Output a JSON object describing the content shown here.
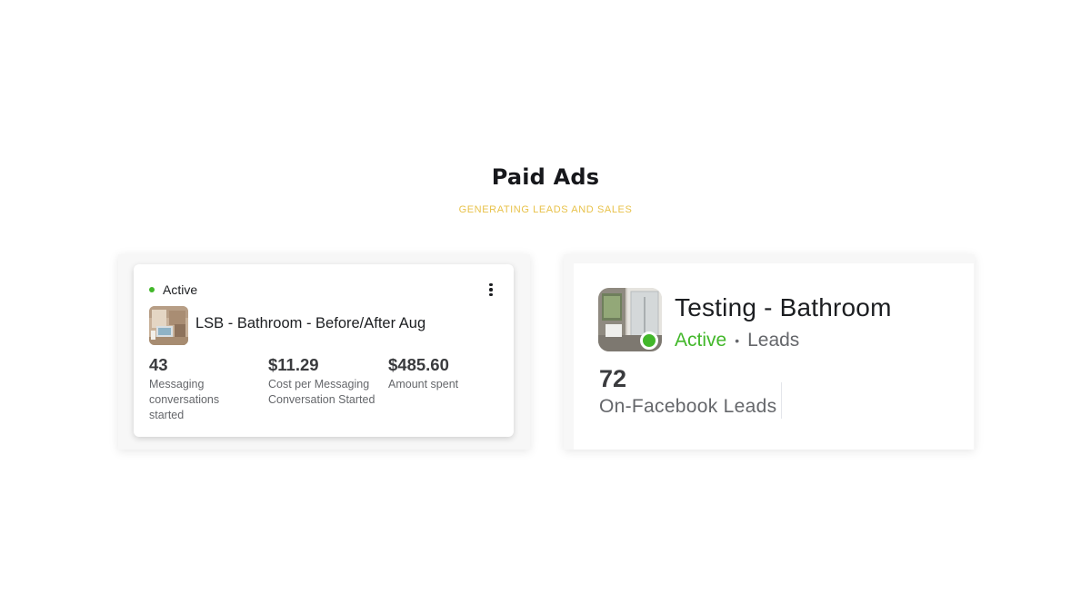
{
  "header": {
    "title": "Paid Ads",
    "subtitle": "GENERATING LEADS AND SALES"
  },
  "colors": {
    "active_green": "#42b72a",
    "title": "#17181c",
    "subtitle": "#e8c24a",
    "muted_text": "#65676b"
  },
  "left_ad": {
    "status": "Active",
    "name": "LSB - Bathroom - Before/After Aug",
    "more_icon": "more-vertical-icon",
    "metrics": [
      {
        "value": "43",
        "label": "Messaging conversations started"
      },
      {
        "value": "$11.29",
        "label": "Cost per Messaging Conversation Started"
      },
      {
        "value": "$485.60",
        "label": "Amount spent"
      }
    ]
  },
  "right_ad": {
    "name": "Testing - Bathroom",
    "status": "Active",
    "separator": "•",
    "type": "Leads",
    "result_value": "72",
    "result_label": "On-Facebook Leads"
  }
}
